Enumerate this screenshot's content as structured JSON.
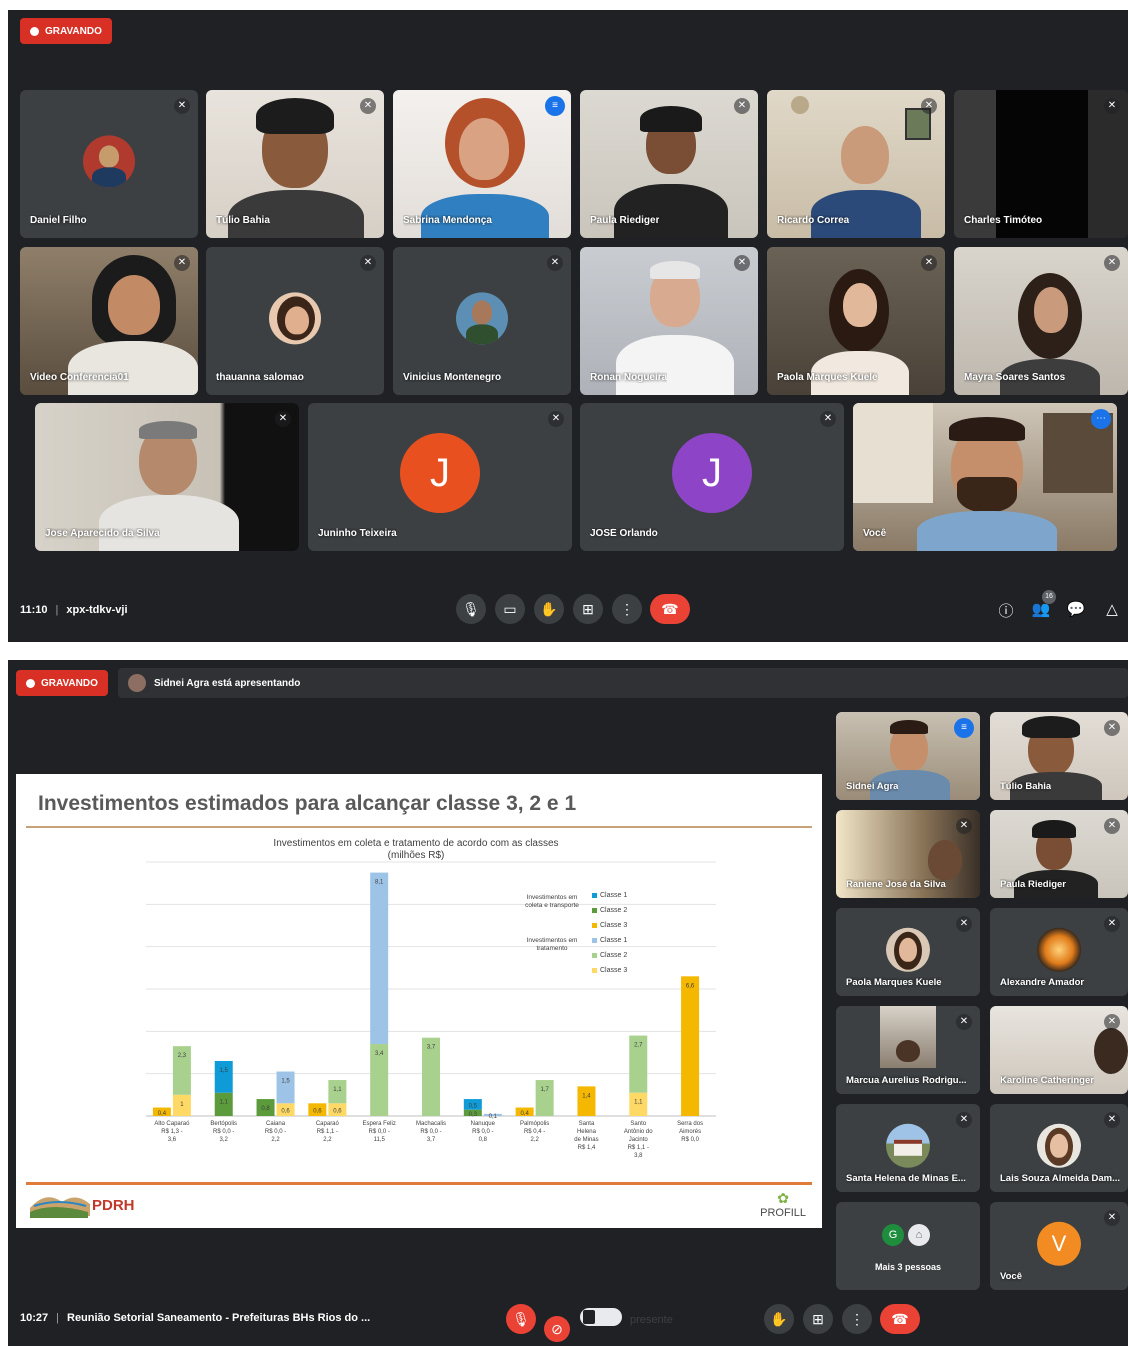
{
  "screen1": {
    "recording_label": "GRAVANDO",
    "participants": [
      {
        "name": "Daniel Filho"
      },
      {
        "name": "Túlio Bahia"
      },
      {
        "name": "Sabrina Mendonça"
      },
      {
        "name": "Paula Riediger"
      },
      {
        "name": "Ricardo Correa"
      },
      {
        "name": "Charles Timóteo"
      },
      {
        "name": "Video Conferencia01"
      },
      {
        "name": "thauanna salomao"
      },
      {
        "name": "Vinicius Montenegro"
      },
      {
        "name": "Ronan Nogueira"
      },
      {
        "name": "Paola Marques Kuele"
      },
      {
        "name": "Mayra Soares Santos"
      },
      {
        "name": "Jose Aparecido da Silva"
      },
      {
        "name": "Juninho Teixeira",
        "initial": "J",
        "color": "#e8511f"
      },
      {
        "name": "JOSÉ Orlando",
        "initial": "J",
        "color": "#8e44c7"
      },
      {
        "name": "Você"
      }
    ],
    "time": "11:10",
    "meeting_code": "xpx-tdkv-vji",
    "participant_count_badge": "16"
  },
  "screen2": {
    "recording_label": "GRAVANDO",
    "presenting_text": "Sidnei Agra está apresentando",
    "slide": {
      "title": "Investimentos estimados para alcançar classe 3, 2 e 1",
      "chart_title_line1": "Investimentos em coleta e tratamento de acordo com as classes",
      "chart_title_line2": "(milhões R$)",
      "legend_group1": "Investimentos em coleta e transporte",
      "legend_group2": "Investimentos em tratamento",
      "legend_labels": [
        "Classe 1",
        "Classe 2",
        "Classe 3",
        "Classe 1",
        "Classe 2",
        "Classe 3"
      ],
      "logo_left": "PDRH",
      "logo_right": "PROFILL"
    },
    "chart_data": {
      "type": "bar",
      "title": "Investimentos em coleta e tratamento de acordo com as classes",
      "subtitle": "(milhões R$)",
      "categories": [
        [
          "Alto Caparaó",
          "R$ 1,3 -",
          "3,6"
        ],
        [
          "Bertópolis",
          "R$ 0,0 -",
          "3,2"
        ],
        [
          "Caiana",
          "R$ 0,0 -",
          "2,2"
        ],
        [
          "Caparaó",
          "R$ 1,1 -",
          "2,2"
        ],
        [
          "Espera Feliz",
          "R$ 0,0 -",
          "11,5"
        ],
        [
          "Machacalis",
          "R$ 0,0 -",
          "3,7"
        ],
        [
          "Nanuque",
          "R$ 0,0 -",
          "0,8"
        ],
        [
          "Palmópolis",
          "R$ 0,4 -",
          "2,2"
        ],
        [
          "Santa",
          "Helena",
          "de Minas",
          "R$ 1,4"
        ],
        [
          "Santo",
          "Antônio do",
          "Jacinto",
          "R$ 1,1 -",
          "3,8"
        ],
        [
          "Serra dos",
          "Aimorés",
          "R$ 0,0"
        ]
      ],
      "series": [
        {
          "name": "Classe 1",
          "group": "Investimentos em coleta e transporte",
          "color": "#0e9bd8",
          "values": [
            0,
            1.5,
            0,
            0,
            0,
            0,
            0.5,
            0,
            0,
            0,
            0
          ]
        },
        {
          "name": "Classe 2",
          "group": "Investimentos em coleta e transporte",
          "color": "#5b9b3c",
          "values": [
            0,
            1.1,
            0.8,
            0,
            0,
            0,
            0.3,
            0,
            0,
            0,
            0
          ]
        },
        {
          "name": "Classe 3",
          "group": "Investimentos em coleta e transporte",
          "color": "#f5b800",
          "values": [
            0.4,
            0,
            0,
            0.6,
            0,
            0,
            0,
            0.4,
            1.4,
            0,
            6.6
          ]
        },
        {
          "name": "Classe 1",
          "group": "Investimentos em tratamento",
          "color": "#9dc3e6",
          "values": [
            0,
            0,
            1.5,
            0,
            8.1,
            0,
            0.1,
            0,
            0,
            0,
            0
          ]
        },
        {
          "name": "Classe 2",
          "group": "Investimentos em tratamento",
          "color": "#a9d18e",
          "values": [
            2.3,
            0,
            0,
            1.1,
            3.4,
            3.7,
            0,
            1.7,
            0,
            2.7,
            0
          ]
        },
        {
          "name": "Classe 3",
          "group": "Investimentos em tratamento",
          "color": "#ffd966",
          "values": [
            1.0,
            0,
            0.6,
            0.6,
            0,
            0,
            0,
            0,
            0,
            1.1,
            0
          ]
        }
      ],
      "grid": true,
      "legend": "top-right"
    },
    "side_participants": [
      {
        "name": "Sidnei Agra"
      },
      {
        "name": "Túlio Bahia"
      },
      {
        "name": "Raniene José da Silva"
      },
      {
        "name": "Paula Riediger"
      },
      {
        "name": "Paola Marques Kuele"
      },
      {
        "name": "Alexandre Amador"
      },
      {
        "name": "Marcua Aurelius Rodrigu..."
      },
      {
        "name": "Karoline Catheringer"
      },
      {
        "name": "Santa Helena de Minas E..."
      },
      {
        "name": "Lais Souza Almeida Dam..."
      },
      {
        "name": "Mais 3 pessoas",
        "initial": "G"
      },
      {
        "name": "Você",
        "initial": "V",
        "color": "#f28b22"
      }
    ],
    "time": "10:27",
    "meeting_title": "Reunião Setorial Saneamento - Prefeituras BHs Rios do ...",
    "presence_label": "presente"
  }
}
